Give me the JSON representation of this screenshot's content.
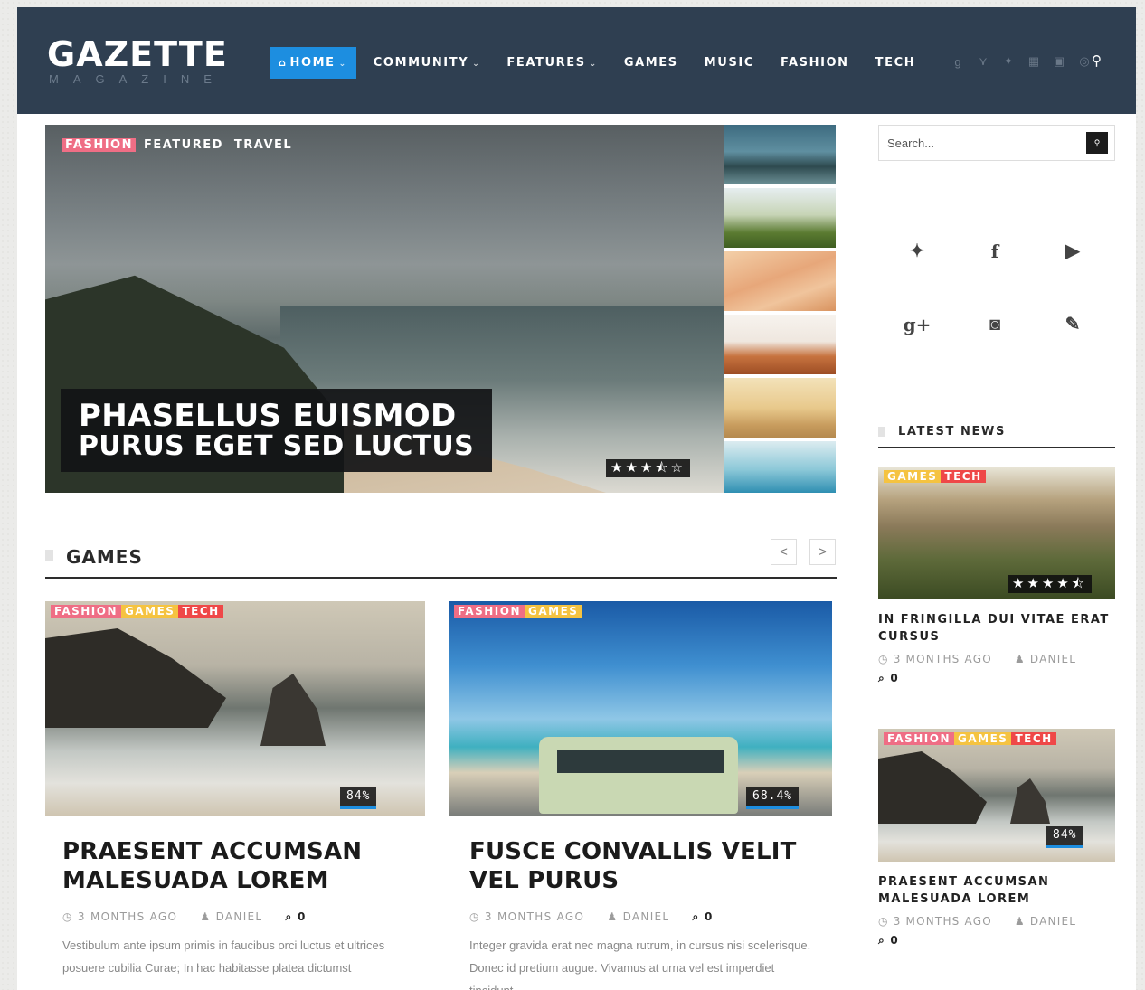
{
  "header": {
    "logo": "GAZETTE",
    "logo_sub": "MAGAZINE",
    "nav": [
      {
        "label": "HOME",
        "dropdown": true,
        "active": true
      },
      {
        "label": "COMMUNITY",
        "dropdown": true
      },
      {
        "label": "FEATURES",
        "dropdown": true
      },
      {
        "label": "GAMES"
      },
      {
        "label": "MUSIC"
      },
      {
        "label": "FASHION"
      },
      {
        "label": "TECH"
      }
    ],
    "social_icons": [
      "google-plus-icon",
      "vine-icon",
      "twitter-icon",
      "soundcloud-icon",
      "linkedin-icon",
      "dribbble-icon"
    ],
    "search_icon": "search-icon"
  },
  "hero": {
    "tags": [
      "FASHION",
      "FEATURED",
      "TRAVEL"
    ],
    "title_line1": "PHASELLUS EUISMOD",
    "title_line2": "PURUS EGET SED LUCTUS",
    "rating": 3.5,
    "rating_stars": "★★★⯪☆"
  },
  "games": {
    "title": "GAMES",
    "prev": "<",
    "next": ">",
    "cards": [
      {
        "tags": [
          "FASHION",
          "GAMES",
          "TECH"
        ],
        "score": "84%",
        "score_value": 84,
        "title": "PRAESENT ACCUMSAN MALESUADA LOREM",
        "date": "3 MONTHS AGO",
        "author": "DANIEL",
        "comments": "0",
        "excerpt": "Vestibulum ante ipsum primis in faucibus orci luctus et ultrices posuere cubilia Curae; In hac habitasse platea dictumst"
      },
      {
        "tags": [
          "FASHION",
          "GAMES"
        ],
        "score": "68.4%",
        "score_value": 68.4,
        "title": "FUSCE CONVALLIS VELIT VEL PURUS",
        "date": "3 MONTHS AGO",
        "author": "DANIEL",
        "comments": "0",
        "excerpt": "Integer gravida erat nec magna rutrum, in cursus nisi scelerisque. Donec id pretium augue. Vivamus at urna vel est imperdiet tincidunt"
      }
    ]
  },
  "sidebar": {
    "search_placeholder": "Search...",
    "social": [
      "twitter-icon",
      "facebook-icon",
      "youtube-icon",
      "google-plus-icon",
      "instagram-icon",
      "edit-icon"
    ],
    "latest_news": "LATEST NEWS",
    "items": [
      {
        "tags": [
          "GAMES",
          "TECH"
        ],
        "rating_stars": "★★★★⯪",
        "rating": 4.5,
        "title": "IN FRINGILLA DUI VITAE ERAT CURSUS",
        "date": "3 MONTHS AGO",
        "author": "DANIEL",
        "comments": "0"
      },
      {
        "tags": [
          "FASHION",
          "GAMES",
          "TECH"
        ],
        "score": "84%",
        "score_value": 84,
        "title": "PRAESENT ACCUMSAN MALESUADA LOREM",
        "date": "3 MONTHS AGO",
        "author": "DANIEL",
        "comments": "0"
      }
    ]
  },
  "colors": {
    "header_bg": "#2f3f51",
    "accent": "#1d8ee0",
    "tag_fashion": "#ef6e85",
    "tag_games": "#f5c341",
    "tag_tech": "#ef4848"
  }
}
